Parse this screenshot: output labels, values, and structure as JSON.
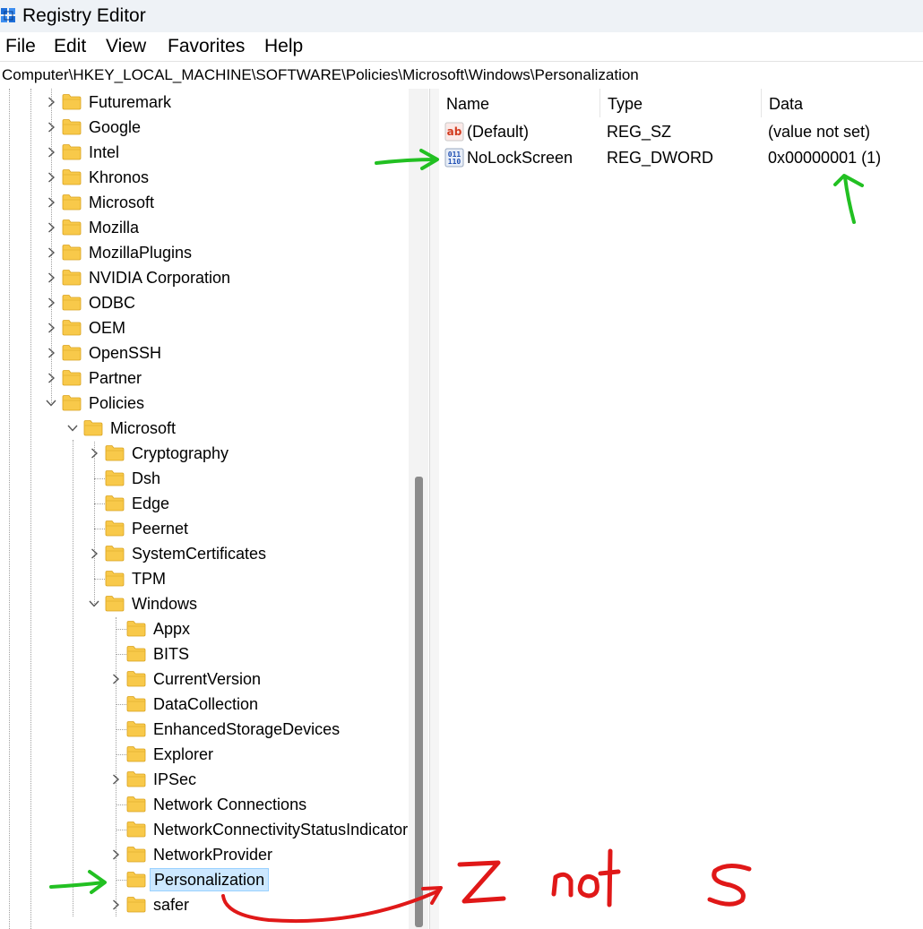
{
  "window": {
    "title": "Registry Editor"
  },
  "menu": [
    "File",
    "Edit",
    "View",
    "Favorites",
    "Help"
  ],
  "address": "Computer\\HKEY_LOCAL_MACHINE\\SOFTWARE\\Policies\\Microsoft\\Windows\\Personalization",
  "tree": [
    {
      "label": "Futuremark",
      "level": 0,
      "expander": "collapsed"
    },
    {
      "label": "Google",
      "level": 0,
      "expander": "collapsed"
    },
    {
      "label": "Intel",
      "level": 0,
      "expander": "collapsed"
    },
    {
      "label": "Khronos",
      "level": 0,
      "expander": "collapsed"
    },
    {
      "label": "Microsoft",
      "level": 0,
      "expander": "collapsed"
    },
    {
      "label": "Mozilla",
      "level": 0,
      "expander": "collapsed"
    },
    {
      "label": "MozillaPlugins",
      "level": 0,
      "expander": "collapsed"
    },
    {
      "label": "NVIDIA Corporation",
      "level": 0,
      "expander": "collapsed"
    },
    {
      "label": "ODBC",
      "level": 0,
      "expander": "collapsed"
    },
    {
      "label": "OEM",
      "level": 0,
      "expander": "collapsed"
    },
    {
      "label": "OpenSSH",
      "level": 0,
      "expander": "collapsed"
    },
    {
      "label": "Partner",
      "level": 0,
      "expander": "collapsed"
    },
    {
      "label": "Policies",
      "level": 0,
      "expander": "expanded"
    },
    {
      "label": "Microsoft",
      "level": 1,
      "expander": "expanded"
    },
    {
      "label": "Cryptography",
      "level": 2,
      "expander": "collapsed"
    },
    {
      "label": "Dsh",
      "level": 2,
      "expander": "none"
    },
    {
      "label": "Edge",
      "level": 2,
      "expander": "none"
    },
    {
      "label": "Peernet",
      "level": 2,
      "expander": "none"
    },
    {
      "label": "SystemCertificates",
      "level": 2,
      "expander": "collapsed"
    },
    {
      "label": "TPM",
      "level": 2,
      "expander": "none"
    },
    {
      "label": "Windows",
      "level": 2,
      "expander": "expanded"
    },
    {
      "label": "Appx",
      "level": 3,
      "expander": "none"
    },
    {
      "label": "BITS",
      "level": 3,
      "expander": "none"
    },
    {
      "label": "CurrentVersion",
      "level": 3,
      "expander": "collapsed"
    },
    {
      "label": "DataCollection",
      "level": 3,
      "expander": "none"
    },
    {
      "label": "EnhancedStorageDevices",
      "level": 3,
      "expander": "none"
    },
    {
      "label": "Explorer",
      "level": 3,
      "expander": "none"
    },
    {
      "label": "IPSec",
      "level": 3,
      "expander": "collapsed"
    },
    {
      "label": "Network Connections",
      "level": 3,
      "expander": "none"
    },
    {
      "label": "NetworkConnectivityStatusIndicator",
      "level": 3,
      "expander": "none"
    },
    {
      "label": "NetworkProvider",
      "level": 3,
      "expander": "collapsed"
    },
    {
      "label": "Personalization",
      "level": 3,
      "expander": "none",
      "selected": true
    },
    {
      "label": "safer",
      "level": 3,
      "expander": "collapsed"
    }
  ],
  "values_table": {
    "columns": [
      "Name",
      "Type",
      "Data"
    ],
    "rows": [
      {
        "name": "(Default)",
        "type": "REG_SZ",
        "data": "(value not set)",
        "icon": "string-value-icon"
      },
      {
        "name": "NoLockScreen",
        "type": "REG_DWORD",
        "data": "0x00000001 (1)",
        "icon": "binary-value-icon"
      }
    ]
  },
  "scrollbar": {
    "visible_fraction": 0.57,
    "position_fraction": 1.0
  },
  "annotations": {
    "handwritten_text": [
      "Z",
      "not",
      "S"
    ],
    "arrow_colors": {
      "green": "#22c022",
      "red": "#e01818"
    }
  },
  "colors": {
    "selection_bg": "#cce8ff",
    "selection_border": "#99d1ff",
    "folder": "#f8c94a",
    "titlebar": "#eef2f6"
  }
}
